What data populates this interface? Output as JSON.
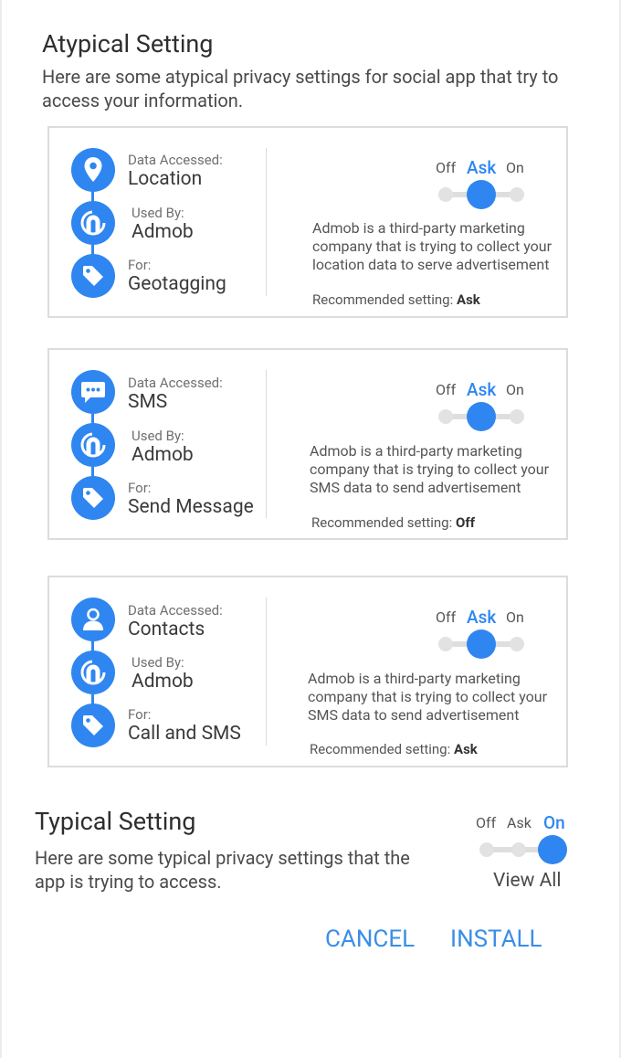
{
  "atypical": {
    "title": "Atypical Setting",
    "description": "Here are some atypical privacy settings for social app that try to access your information."
  },
  "cards": [
    {
      "data_label": "Data Accessed:",
      "data_value": "Location",
      "data_icon": "location-pin-icon",
      "used_label": "Used By:",
      "used_value": "Admob",
      "used_icon": "admob-icon",
      "for_label": "For:",
      "for_value": "Geotagging",
      "for_icon": "tag-icon",
      "toggle": {
        "off": "Off",
        "ask": "Ask",
        "on": "On",
        "selected": "Ask"
      },
      "description": "Admob is a third-party marketing company that is trying to collect your location data to serve advertisement",
      "recommended_label": "Recommended setting:",
      "recommended_value": "Ask"
    },
    {
      "data_label": "Data Accessed:",
      "data_value": "SMS",
      "data_icon": "sms-chat-icon",
      "used_label": "Used By:",
      "used_value": "Admob",
      "used_icon": "admob-icon",
      "for_label": "For:",
      "for_value": "Send Message",
      "for_icon": "tag-icon",
      "toggle": {
        "off": "Off",
        "ask": "Ask",
        "on": "On",
        "selected": "Ask"
      },
      "description": "Admob is a third-party marketing company that is trying to collect your SMS data to send advertisement",
      "recommended_label": "Recommended setting:",
      "recommended_value": "Off"
    },
    {
      "data_label": "Data Accessed:",
      "data_value": "Contacts",
      "data_icon": "person-icon",
      "used_label": "Used By:",
      "used_value": "Admob",
      "used_icon": "admob-icon",
      "for_label": "For:",
      "for_value": "Call and SMS",
      "for_icon": "tag-icon",
      "toggle": {
        "off": "Off",
        "ask": "Ask",
        "on": "On",
        "selected": "Ask"
      },
      "description": "Admob is a third-party marketing company that is trying to collect your SMS data to send advertisement",
      "recommended_label": "Recommended setting:",
      "recommended_value": "Ask"
    }
  ],
  "typical": {
    "title": "Typical Setting",
    "description": "Here are some typical privacy settings that the app is trying to access.",
    "toggle": {
      "off": "Off",
      "ask": "Ask",
      "on": "On",
      "selected": "On"
    },
    "view_all": "View All"
  },
  "actions": {
    "cancel": "CANCEL",
    "install": "INSTALL"
  },
  "colors": {
    "accent": "#2f86f0",
    "button_text": "#3a8ee6"
  }
}
